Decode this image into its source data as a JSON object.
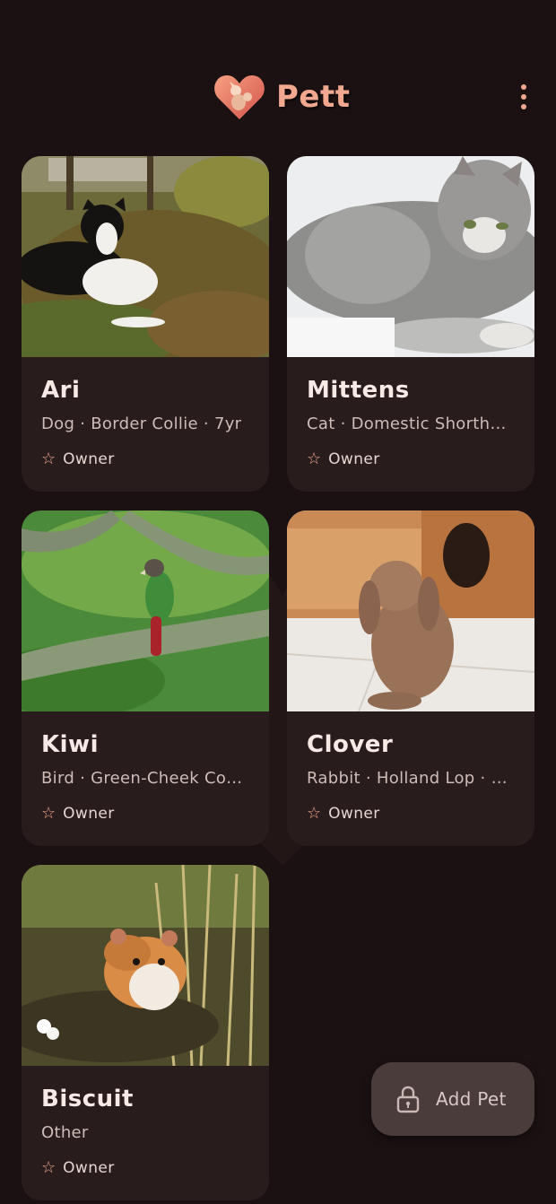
{
  "app": {
    "title": "Pett"
  },
  "header": {
    "logo_icon": "heart-pet-logo-icon",
    "menu_icon": "more-vert-icon"
  },
  "colors": {
    "background": "#1b1112",
    "card": "#291c1d",
    "accent": "#f2a88e",
    "fab": "#4a3c3b"
  },
  "pets": [
    {
      "name": "Ari",
      "meta": "Dog · Border Collie · 7yr",
      "role": "Owner",
      "role_icon": "star-icon"
    },
    {
      "name": "Mittens",
      "meta": "Cat · Domestic Shorth…",
      "role": "Owner",
      "role_icon": "star-icon"
    },
    {
      "name": "Kiwi",
      "meta": "Bird · Green-Cheek Co…",
      "role": "Owner",
      "role_icon": "star-icon"
    },
    {
      "name": "Clover",
      "meta": "Rabbit · Holland Lop · …",
      "role": "Owner",
      "role_icon": "star-icon"
    },
    {
      "name": "Biscuit",
      "meta": "Other",
      "role": "Owner",
      "role_icon": "star-icon"
    }
  ],
  "fab": {
    "label": "Add Pet",
    "icon": "lock-icon"
  }
}
